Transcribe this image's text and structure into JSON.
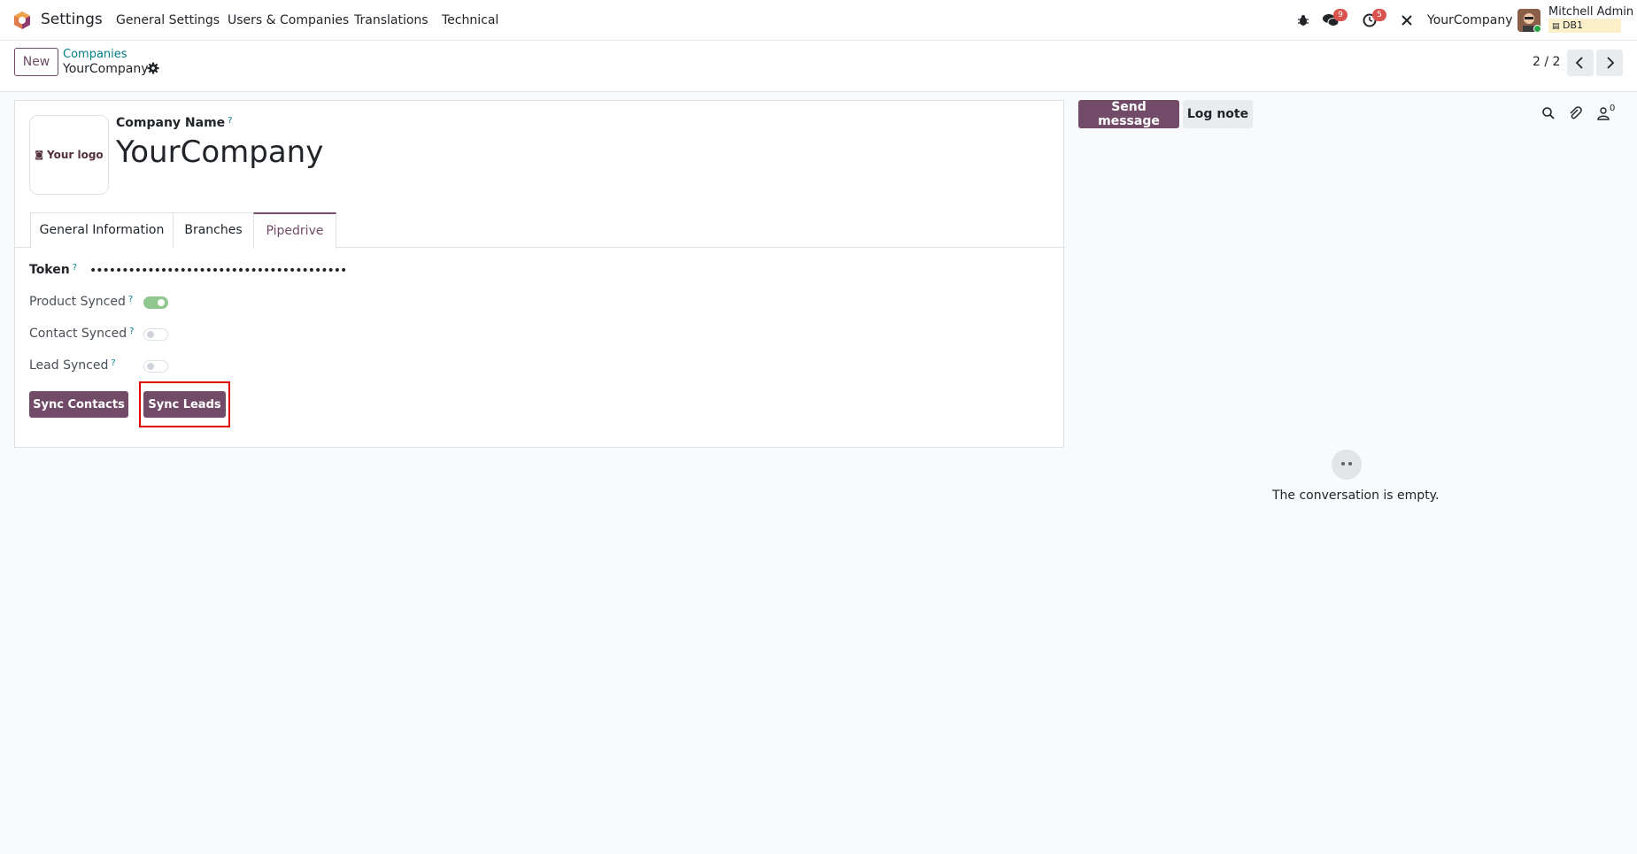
{
  "navbar": {
    "app_name": "Settings",
    "menus": [
      "General Settings",
      "Users & Companies",
      "Translations",
      "Technical"
    ],
    "messages_count": "9",
    "activities_count": "5",
    "company": "YourCompany",
    "user_name": "Mitchell Admin",
    "database": "DB1"
  },
  "control_panel": {
    "new_label": "New",
    "breadcrumb_parent": "Companies",
    "breadcrumb_current": "YourCompany",
    "pager": "2 / 2"
  },
  "form": {
    "logo_placeholder": "Your logo",
    "company_name_label": "Company Name",
    "company_name": "YourCompany",
    "help_mark": "?",
    "tabs": [
      "General Information",
      "Branches",
      "Pipedrive"
    ],
    "active_tab": "Pipedrive",
    "token_label": "Token",
    "token_value": "••••••••••••••••••••••••••••••••••••••••",
    "product_synced_label": "Product Synced",
    "product_synced": true,
    "contact_synced_label": "Contact Synced",
    "contact_synced": false,
    "lead_synced_label": "Lead Synced",
    "lead_synced": false,
    "sync_contacts_label": "Sync Contacts",
    "sync_leads_label": "Sync Leads"
  },
  "chatter": {
    "send_message_label": "Send message",
    "log_note_label": "Log note",
    "followers_count": "0",
    "empty_text": "The conversation is empty."
  },
  "colors": {
    "brand": "#714b67",
    "link": "#017e84",
    "badge": "#d9534f",
    "highlight": "#e00000"
  }
}
